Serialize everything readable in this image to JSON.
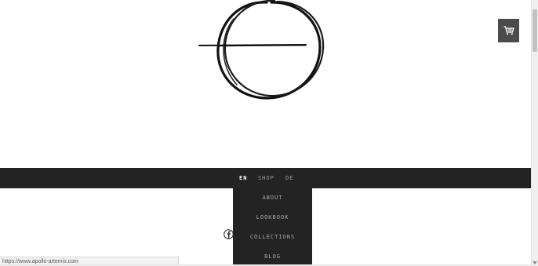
{
  "brand": {
    "logo_icon": "circle-horizon-logo"
  },
  "cart": {
    "icon": "shopping-cart-icon"
  },
  "nav": {
    "items": [
      {
        "label": "EN",
        "active": true
      },
      {
        "label": "SHOP",
        "active": false
      },
      {
        "label": "DE",
        "active": false
      }
    ]
  },
  "dropdown": {
    "items": [
      {
        "label": "ABOUT"
      },
      {
        "label": "LOOKBOOK"
      },
      {
        "label": "COLLECTIONS"
      },
      {
        "label": "BLOG"
      }
    ]
  },
  "social": {
    "facebook_icon": "facebook-icon"
  },
  "status": {
    "url": "https://www.apollo-artemis.com"
  },
  "colors": {
    "navbar": "#232323",
    "cart_button": "#4b4b4b",
    "nav_text": "#9a9a9a",
    "nav_active": "#ffffff"
  }
}
